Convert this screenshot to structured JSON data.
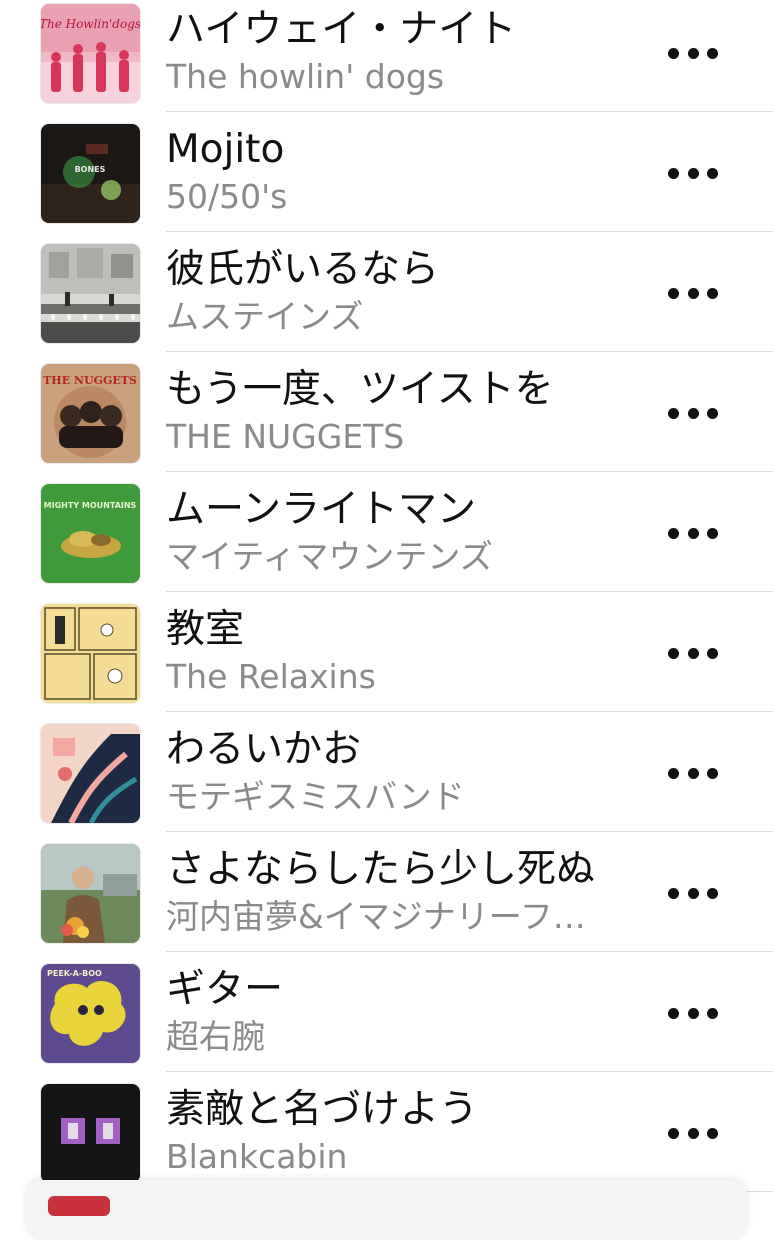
{
  "songs": [
    {
      "title": "ハイウェイ・ナイト",
      "artist": "The howlin' dogs",
      "art": "howlin-dogs-cover",
      "art_text": "The Howlin'dogs"
    },
    {
      "title": "Mojito",
      "artist": "50/50's",
      "art": "bones-cover",
      "art_text": "BONES"
    },
    {
      "title": "彼氏がいるなら",
      "artist": "ムステインズ",
      "art": "street-photo-cover",
      "art_text": ""
    },
    {
      "title": "もう一度、ツイストを",
      "artist": "THE NUGGETS",
      "art": "nuggets-cover",
      "art_text": "THE NUGGETS"
    },
    {
      "title": "ムーンライトマン",
      "artist": "マイティマウンテンズ",
      "art": "mighty-mountains-cover",
      "art_text": "MIGHTY MOUNTAINS"
    },
    {
      "title": "教室",
      "artist": "The Relaxins",
      "art": "relaxins-comic-cover",
      "art_text": ""
    },
    {
      "title": "わるいかお",
      "artist": "モテギスミスバンド",
      "art": "illustration-cover",
      "art_text": ""
    },
    {
      "title": "さよならしたら少し死ぬ",
      "artist": "河内宙夢&イマジナリーフ…",
      "art": "portrait-cover",
      "art_text": ""
    },
    {
      "title": "ギター",
      "artist": "超右腕",
      "art": "peek-a-boo-cover",
      "art_text": "PEEK-A-BOO"
    },
    {
      "title": "素敵と名づけよう",
      "artist": "Blankcabin",
      "art": "blankcabin-cover",
      "art_text": ""
    }
  ],
  "more_icon": "ellipsis-icon",
  "colors": {
    "title": "#111111",
    "subtitle": "#8a8a8e",
    "separator": "#dcdcdf",
    "background": "#ffffff"
  }
}
